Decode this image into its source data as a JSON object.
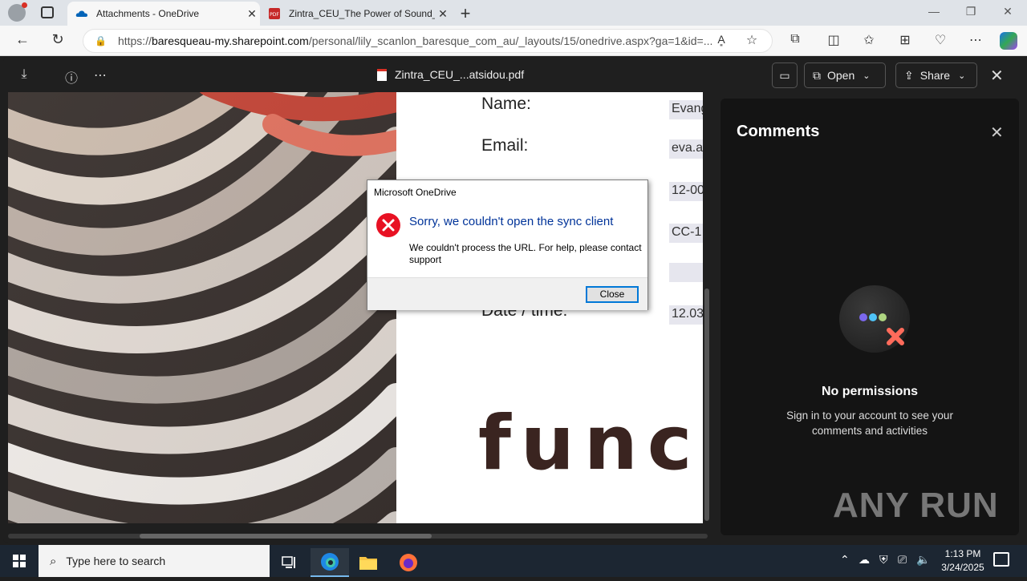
{
  "browser": {
    "tabs": [
      {
        "title": "Attachments - OneDrive",
        "active": true
      },
      {
        "title": "Zintra_CEU_The Power of Sound_",
        "active": false
      }
    ],
    "url": {
      "scheme": "https://",
      "domain": "baresqueau-my.sharepoint.com",
      "path": "/personal/lily_scanlon_baresque_com_au/_layouts/15/onedrive.aspx?ga=1&id=..."
    }
  },
  "viewer": {
    "filename": "Zintra_CEU_...atsidou.pdf",
    "open_label": "Open",
    "share_label": "Share"
  },
  "document": {
    "fields": [
      {
        "label": "Name:",
        "value": "Evang"
      },
      {
        "label": "Email:",
        "value": "eva.a"
      },
      {
        "label": "",
        "value": "12-00"
      },
      {
        "label": "",
        "value": "CC-1"
      },
      {
        "label": "",
        "value": ""
      },
      {
        "label": "Date / time:",
        "value": "12.03"
      }
    ],
    "brand_text": "func"
  },
  "comments": {
    "title": "Comments",
    "empty_title": "No permissions",
    "empty_text": "Sign in to your account to see your comments and activities"
  },
  "dialog": {
    "title": "Microsoft OneDrive",
    "heading": "Sorry, we couldn't open the sync client",
    "message": "We couldn't process the URL. For help, please contact support",
    "button": "Close"
  },
  "taskbar": {
    "search_placeholder": "Type here to search",
    "time": "1:13 PM",
    "date": "3/24/2025"
  },
  "watermark": "ANY RUN"
}
